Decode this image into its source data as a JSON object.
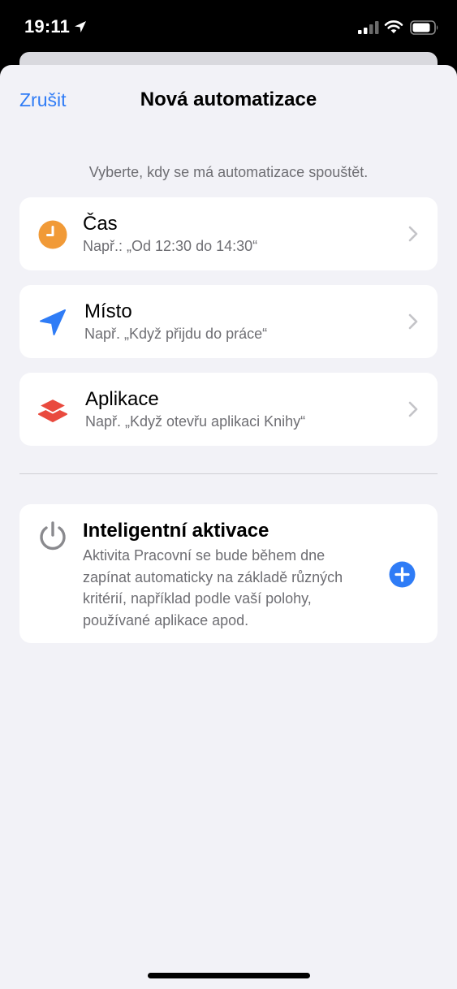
{
  "status_bar": {
    "time": "19:11",
    "icons": [
      "location-arrow-icon",
      "cellular-signal-icon",
      "wifi-icon",
      "battery-icon"
    ]
  },
  "nav": {
    "cancel_label": "Zrušit",
    "title": "Nová automatizace"
  },
  "prompt": "Vyberte, kdy se má automatizace spouštět.",
  "triggers": [
    {
      "icon": "clock-icon",
      "icon_color": "#f19a37",
      "title": "Čas",
      "subtitle": "Např.: „Od 12:30 do 14:30“"
    },
    {
      "icon": "location-arrow-icon",
      "icon_color": "#2f7cf6",
      "title": "Místo",
      "subtitle": "Např. „Když přijdu do práce“"
    },
    {
      "icon": "app-stack-icon",
      "icon_color": "#e94a3e",
      "title": "Aplikace",
      "subtitle": "Např. „Když otevřu aplikaci Knihy“"
    }
  ],
  "smart_activation": {
    "icon": "power-icon",
    "title": "Inteligentní aktivace",
    "description": "Aktivita Pracovní se bude během dne zapínat automaticky na základě různých kritérií, například podle vaší polohy, používané aplikace apod.",
    "add_icon": "plus-circle-icon"
  },
  "colors": {
    "accent": "#2f7cf6",
    "background": "#f2f2f7",
    "card": "#ffffff",
    "secondary_text": "#6e6e73"
  }
}
